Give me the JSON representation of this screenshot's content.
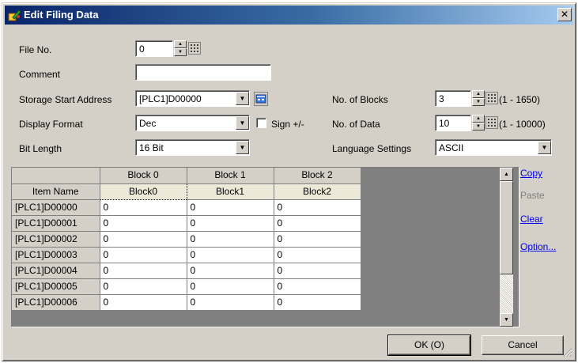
{
  "window": {
    "title": "Edit Filing Data",
    "close_glyph": "✕"
  },
  "form": {
    "file_no_label": "File No.",
    "file_no_value": "0",
    "comment_label": "Comment",
    "comment_value": "",
    "storage_label": "Storage Start Address",
    "storage_value": "[PLC1]D00000",
    "display_format_label": "Display Format",
    "display_format_value": "Dec",
    "sign_label": "Sign +/-",
    "sign_checked": false,
    "bit_length_label": "Bit Length",
    "bit_length_value": "16 Bit",
    "blocks_label": "No. of Blocks",
    "blocks_value": "3",
    "blocks_range": "(1 - 1650)",
    "data_label": "No. of Data",
    "data_value": "10",
    "data_range": "(1 - 10000)",
    "language_label": "Language Settings",
    "language_value": "ASCII"
  },
  "grid": {
    "column_headers": [
      "Block 0",
      "Block 1",
      "Block 2"
    ],
    "item_name_label": "Item Name",
    "block_names": [
      "Block0",
      "Block1",
      "Block2"
    ],
    "rows": [
      {
        "address": "[PLC1]D00000",
        "values": [
          "0",
          "0",
          "0"
        ]
      },
      {
        "address": "[PLC1]D00001",
        "values": [
          "0",
          "0",
          "0"
        ]
      },
      {
        "address": "[PLC1]D00002",
        "values": [
          "0",
          "0",
          "0"
        ]
      },
      {
        "address": "[PLC1]D00003",
        "values": [
          "0",
          "0",
          "0"
        ]
      },
      {
        "address": "[PLC1]D00004",
        "values": [
          "0",
          "0",
          "0"
        ]
      },
      {
        "address": "[PLC1]D00005",
        "values": [
          "0",
          "0",
          "0"
        ]
      },
      {
        "address": "[PLC1]D00006",
        "values": [
          "0",
          "0",
          "0"
        ]
      }
    ]
  },
  "side_links": {
    "copy": "Copy",
    "paste": "Paste",
    "clear": "Clear",
    "option": "Option..."
  },
  "buttons": {
    "ok": "OK (O)",
    "cancel": "Cancel"
  },
  "icons": {
    "title": "edit-icon",
    "keypad": "keypad-icon",
    "address_picker": "address-picker-icon"
  },
  "colors": {
    "title_start": "#0a246a",
    "title_end": "#a6caf0",
    "dialog_bg": "#d4d0c8",
    "link": "#0000ee"
  }
}
